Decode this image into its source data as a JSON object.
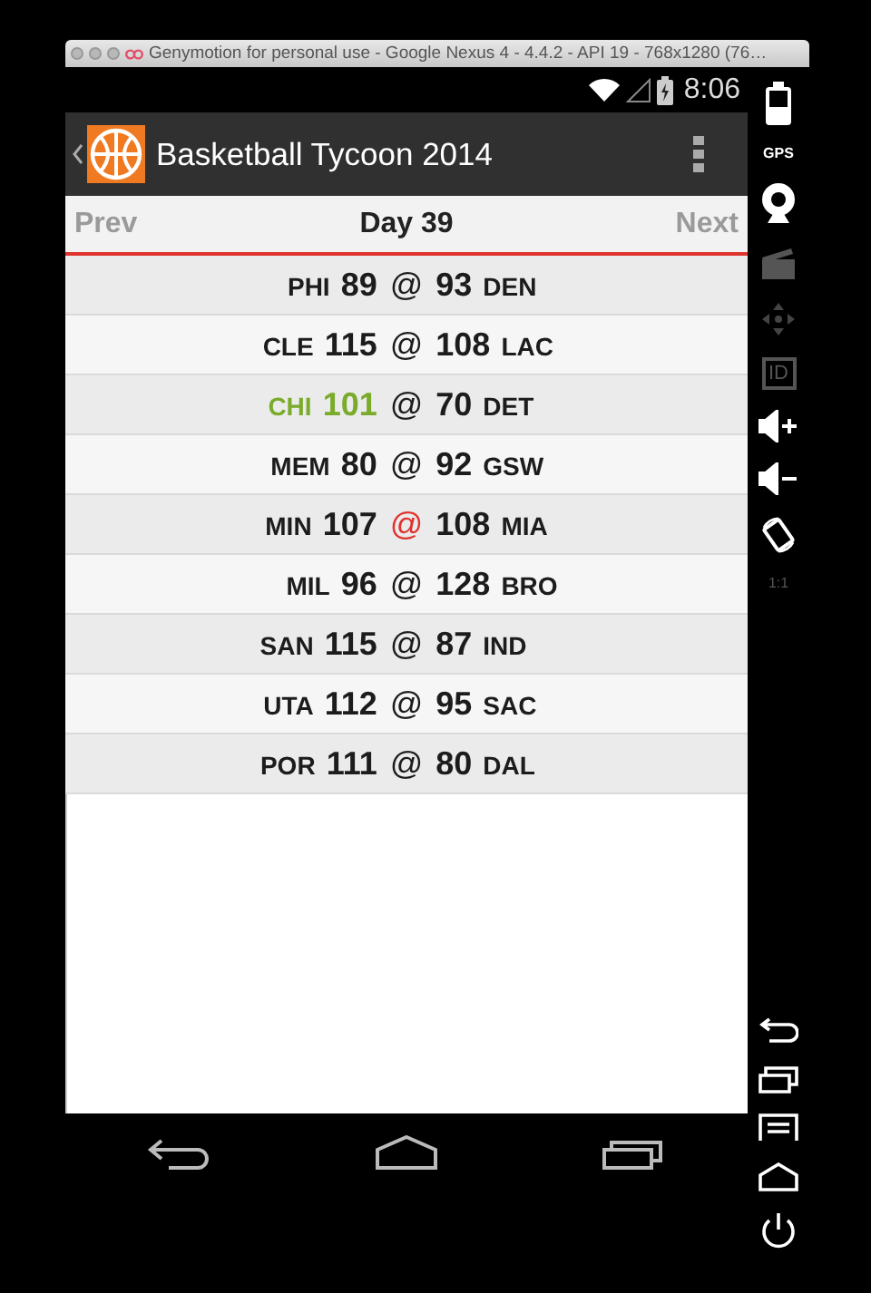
{
  "window": {
    "title": "Genymotion for personal use - Google Nexus 4 - 4.4.2 - API 19 - 768x1280 (76…"
  },
  "status_bar": {
    "time": "8:06"
  },
  "action_bar": {
    "title": "Basketball Tycoon 2014"
  },
  "day_nav": {
    "prev": "Prev",
    "day": "Day 39",
    "next": "Next"
  },
  "games": [
    {
      "away": "PHI",
      "away_score": "89",
      "at": "@",
      "home_score": "93",
      "home": "DEN",
      "kind": "plain"
    },
    {
      "away": "CLE",
      "away_score": "115",
      "at": "@",
      "home_score": "108",
      "home": "LAC",
      "kind": "plain"
    },
    {
      "away": "CHI",
      "away_score": "101",
      "at": "@",
      "home_score": "70",
      "home": "DET",
      "kind": "highlight"
    },
    {
      "away": "MEM",
      "away_score": "80",
      "at": "@",
      "home_score": "92",
      "home": "GSW",
      "kind": "plain"
    },
    {
      "away": "MIN",
      "away_score": "107",
      "at": "@",
      "home_score": "108",
      "home": "MIA",
      "kind": "alert"
    },
    {
      "away": "MIL",
      "away_score": "96",
      "at": "@",
      "home_score": "128",
      "home": "BRO",
      "kind": "plain"
    },
    {
      "away": "SAN",
      "away_score": "115",
      "at": "@",
      "home_score": "87",
      "home": "IND",
      "kind": "plain"
    },
    {
      "away": "UTA",
      "away_score": "112",
      "at": "@",
      "home_score": "95",
      "home": "SAC",
      "kind": "plain"
    },
    {
      "away": "POR",
      "away_score": "111",
      "at": "@",
      "home_score": "80",
      "home": "DAL",
      "kind": "plain"
    }
  ],
  "side_toolbar": {
    "gps": "GPS",
    "id": "ID",
    "scale": "1:1"
  }
}
